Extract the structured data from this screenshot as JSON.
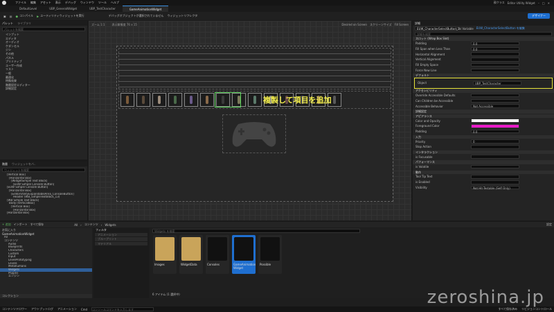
{
  "menu": {
    "items": [
      "ファイル",
      "編集",
      "アセット",
      "表示",
      "デバッグ",
      "ウィンドウ",
      "ツール",
      "ヘルプ"
    ],
    "app_tag": "Editor Utility Widget",
    "parent_class": "親クラス"
  },
  "tabs": [
    "DefaultLevel",
    "UBP_GeneralWidget",
    "UBP_TestCharacter",
    "GameAnimationWidget"
  ],
  "toolbar": {
    "compile": "コンパイル",
    "run": "ユーティリティウィジェットを実行",
    "debug": "デバッグオブジェクトが選択されていません",
    "reflector": "ウィジェットリフレクタ",
    "designer": "デザイナー"
  },
  "palette": {
    "title": "パレット",
    "library": "ライブラリ",
    "search_placeholder": "パレットを検索",
    "categories": [
      "インプット",
      "エディタ",
      "オーディオ",
      "ケダンセル",
      "ジシ",
      "その他",
      "パネル",
      "プリミティブ",
      "ユーザー作成",
      "リスト",
      "一般",
      "最適化",
      "特殊効果",
      "階層設定エディター",
      "詳細設定"
    ]
  },
  "hierarchy": {
    "title": "階層",
    "bind": "ウィジェットをバ..",
    "search_placeholder": "ウィジェットを検索",
    "items": [
      "[Vertical Box]",
      "[Horizontal Box]",
      "[WidgetSimple Text Block]",
      "[EUW Simple Console Button]",
      "[EUW Simple Console Button]",
      "[Horizontal Box]",
      "[EditorUtilityExpandableArea_ConsoleButton]",
      "Header (WB_SimpleTextBlock_13)",
      "[WB Simple Text Block]",
      "Body [VerticalBox]",
      "[Vertical Box]",
      "[Horizontal Box]",
      "[Horizontal Box]"
    ]
  },
  "designer": {
    "zoom": "ズーム 1:1",
    "screen_size": "スクリーンサイズ",
    "fill_screen": "Fill Screen",
    "mode": "Desired on Screen",
    "annotation": "複製して項目を追加",
    "info": "表示解像度 76 x 15"
  },
  "details": {
    "title": "詳細",
    "widget_name": "EUW_CharacterSelectButton_1",
    "is_variable": "Is Variable",
    "class_link": "EUW_CharacterSelectButton を編集",
    "search_placeholder": "詳細を検索",
    "sections": [
      {
        "name": "スロット (Wrap Box Slot)",
        "rows": [
          {
            "label": "Padding",
            "value": "0.0"
          },
          {
            "label": "Fill Span when Less Than",
            "value": "0.0"
          },
          {
            "label": "Horizontal Alignment",
            "value": ""
          },
          {
            "label": "Vertical Alignment",
            "value": ""
          },
          {
            "label": "Fill Empty Space",
            "value": ""
          },
          {
            "label": "Force New Line",
            "value": ""
          }
        ]
      },
      {
        "name": "デフォルト",
        "rows": [
          {
            "label": "Object",
            "value": "UBP_TestCharacter"
          }
        ]
      },
      {
        "name": "アクセシビリティ",
        "rows": [
          {
            "label": "Override Accessible Defaults",
            "value": ""
          },
          {
            "label": "Can Children be Accessible",
            "value": ""
          },
          {
            "label": "Accessible Behavior",
            "value": "Not Accessible"
          }
        ]
      },
      {
        "name": "詳細設定",
        "rows": []
      },
      {
        "name": "アピアランス",
        "rows": [
          {
            "label": "Color and Opacity",
            "value": ""
          },
          {
            "label": "Foreground Color",
            "value": ""
          },
          {
            "label": "Padding",
            "value": "0.0"
          }
        ]
      },
      {
        "name": "入力",
        "rows": [
          {
            "label": "Priority",
            "value": "0"
          },
          {
            "label": "Stop Action",
            "value": ""
          }
        ]
      },
      {
        "name": "インタラクション",
        "rows": [
          {
            "label": "is Focusable",
            "value": ""
          }
        ]
      },
      {
        "name": "パフォーマンス",
        "rows": [
          {
            "label": "is Volatile",
            "value": ""
          }
        ]
      },
      {
        "name": "動作",
        "rows": [
          {
            "label": "Tool Tip Text",
            "value": ""
          },
          {
            "label": "is Enabled",
            "value": ""
          },
          {
            "label": "Visibility",
            "value": "Not Hit-Testable (Self Only)"
          }
        ]
      }
    ],
    "bind_label": "バインド",
    "edit_label": "新規"
  },
  "content": {
    "add": "+ 追加",
    "import": "インポート",
    "save_all": "すべて保存",
    "path": [
      "All",
      "コンテンツ",
      "Widgets"
    ],
    "settings": "設定",
    "favorites": "お気に入り",
    "project": "GameAnimationWidget",
    "tree": [
      "All",
      "コンテンツ",
      "Audio",
      "Blueprints",
      "Characters",
      "Custom",
      "Input",
      "LevelPrototyping",
      "Levels",
      "Metahumans",
      "Widgets",
      "Plugins",
      "エンジン"
    ],
    "filter": "フィルタ",
    "search_placeholder": "Widgets を検索",
    "filter_items": [
      "アニメーション",
      "ブループリント",
      "マテリアル"
    ],
    "assets": [
      {
        "name": "Images",
        "type": "folder"
      },
      {
        "name": "WidgetData",
        "type": "folder"
      },
      {
        "name": "Consoles",
        "type": "asset"
      },
      {
        "name": "GameAnimation Widget",
        "type": "asset",
        "sub": "エディタユーティリティ"
      },
      {
        "name": "Possible",
        "type": "asset"
      }
    ],
    "count": "6 アイテム (1 選択中)",
    "collection": "コレクション",
    "bottom_tabs": [
      "コンテンツドロワー",
      "アウトプットログ",
      "アニメーション"
    ],
    "cmd": "Cmd",
    "cmd_placeholder": "コンソールコマンドを入力します",
    "status_right": [
      "すべて保存済み",
      "リビジョンコントロール"
    ],
    "view_options": "表示オプション"
  },
  "watermark": "zeroshina.jp"
}
